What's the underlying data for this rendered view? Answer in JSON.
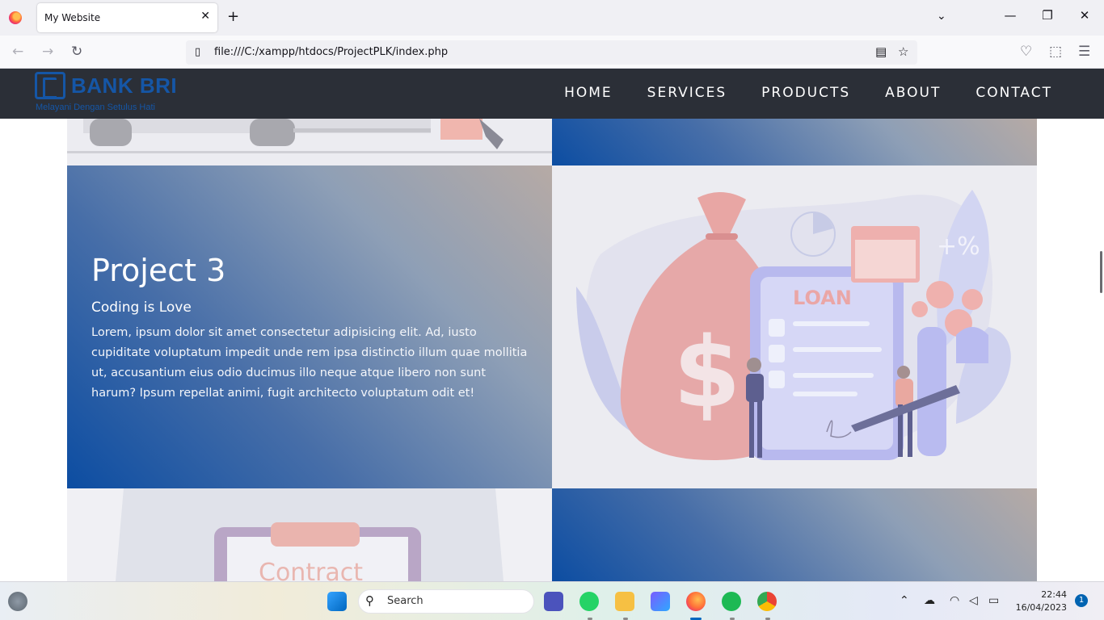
{
  "browser": {
    "tab_title": "My Website",
    "url": "file:///C:/xampp/htdocs/ProjectPLK/index.php"
  },
  "site": {
    "logo_name": "BANK BRI",
    "logo_tagline": "Melayani Dengan Setulus Hati",
    "menu": [
      "HOME",
      "SERVICES",
      "PRODUCTS",
      "ABOUT",
      "CONTACT"
    ],
    "project3": {
      "title": "Project 3",
      "subtitle": "Coding is Love",
      "body": "Lorem, ipsum dolor sit amet consectetur adipisicing elit. Ad, iusto cupiditate voluptatum impedit unde rem ipsa distinctio illum quae mollitia ut, accusantium eius odio ducimus illo neque atque libero non sunt harum? Ipsum repellat animi, fugit architecto voluptatum odit et!"
    },
    "illustration_loan_text": "LOAN",
    "illustration_rate_text": "+%",
    "illustration_contract_text": "Contract"
  },
  "taskbar": {
    "search_placeholder": "Search",
    "time": "22:44",
    "date": "16/04/2023",
    "notification_count": "1"
  },
  "colors": {
    "header_bg": "#2b2f37",
    "brand_blue": "#1556a6",
    "gradient_start": "#0c4da2",
    "gradient_end": "#b6aaa5"
  }
}
